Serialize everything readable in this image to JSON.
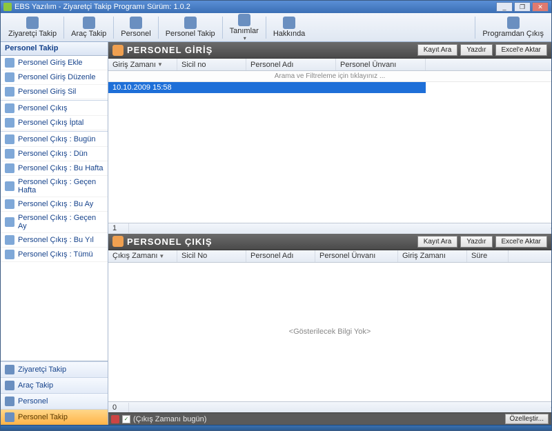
{
  "window": {
    "title": "EBS Yazılım  -  Ziyaretçi Takip Programı Sürüm: 1.0.2"
  },
  "toolbar": {
    "ziyaretci": "Ziyaretçi Takip",
    "arac": "Araç Takip",
    "personel": "Personel",
    "personel_takip": "Personel Takip",
    "tanimlar": "Tanımlar",
    "hakkinda": "Hakkında",
    "cikis": "Programdan Çıkış"
  },
  "sidebar": {
    "header": "Personel Takip",
    "items": [
      {
        "label": "Personel Giriş Ekle"
      },
      {
        "label": "Personel Giriş Düzenle"
      },
      {
        "label": "Personel Giriş Sil"
      },
      {
        "label": "Personel Çıkış"
      },
      {
        "label": "Personel Çıkış İptal"
      },
      {
        "label": "Personel Çıkış : Bugün"
      },
      {
        "label": "Personel Çıkış : Dün"
      },
      {
        "label": "Personel Çıkış : Bu Hafta"
      },
      {
        "label": "Personel Çıkış : Geçen Hafta"
      },
      {
        "label": "Personel Çıkış : Bu Ay"
      },
      {
        "label": "Personel Çıkış : Geçen Ay"
      },
      {
        "label": "Personel Çıkış : Bu Yıl"
      },
      {
        "label": "Personel Çıkış : Tümü"
      }
    ],
    "nav": [
      {
        "label": "Ziyaretçi Takip"
      },
      {
        "label": "Araç Takip"
      },
      {
        "label": "Personel"
      },
      {
        "label": "Personel Takip"
      }
    ]
  },
  "panels": {
    "giris": {
      "title": "PERSONEL GİRİŞ",
      "buttons": {
        "kayit_ara": "Kayıt Ara",
        "yazdir": "Yazdır",
        "excel": "Excel'e Aktar"
      },
      "columns": {
        "giris_zamani": "Giriş Zamanı",
        "sicil_no": "Sicil no",
        "personel_adi": "Personel Adı",
        "personel_unvani": "Personel Ünvanı"
      },
      "filter_hint": "Arama ve Filtreleme için tıklayınız ...",
      "row": {
        "giris_zamani": "10.10.2009 15:58"
      },
      "footer_count": "1"
    },
    "cikis": {
      "title": "PERSONEL ÇIKIŞ",
      "buttons": {
        "kayit_ara": "Kayıt Ara",
        "yazdir": "Yazdır",
        "excel": "Excel'e Aktar"
      },
      "columns": {
        "cikis_zamani": "Çıkış Zamanı",
        "sicil_no": "Sicil No",
        "personel_adi": "Personel Adı",
        "personel_unvani": "Personel Ünvanı",
        "giris_zamani": "Giriş Zamanı",
        "sure": "Süre"
      },
      "empty": "<Gösterilecek Bilgi Yok>",
      "footer_count": "0"
    }
  },
  "status": {
    "filter_text": "(Çıkış Zamanı bugün)",
    "customize": "Özelleştir..."
  }
}
